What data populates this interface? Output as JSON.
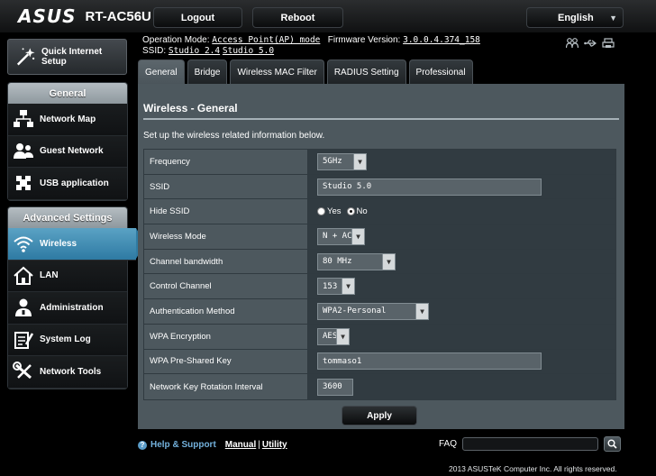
{
  "header": {
    "brand": "ASUS",
    "model": "RT-AC56U",
    "logout_label": "Logout",
    "reboot_label": "Reboot",
    "language": "English"
  },
  "info": {
    "operation_mode_label": "Operation Mode:",
    "operation_mode_value": "Access Point(AP) mode",
    "firmware_label": "Firmware Version:",
    "firmware_value": "3.0.0.4.374_158",
    "ssid_label": "SSID:",
    "ssid_1": "Studio 2.4",
    "ssid_2": "Studio 5.0",
    "status_icons": [
      "clients-icon",
      "usb-icon",
      "printer-icon"
    ]
  },
  "sidebar": {
    "quick_setup_label": "Quick Internet Setup",
    "general_title": "General",
    "general_items": [
      {
        "label": "Network Map",
        "icon": "network-map-icon"
      },
      {
        "label": "Guest Network",
        "icon": "guest-network-icon"
      },
      {
        "label": "USB application",
        "icon": "usb-application-icon"
      }
    ],
    "advanced_title": "Advanced Settings",
    "advanced_items": [
      {
        "label": "Wireless",
        "icon": "wireless-icon",
        "active": true
      },
      {
        "label": "LAN",
        "icon": "lan-icon"
      },
      {
        "label": "Administration",
        "icon": "administration-icon"
      },
      {
        "label": "System Log",
        "icon": "system-log-icon"
      },
      {
        "label": "Network Tools",
        "icon": "network-tools-icon"
      }
    ]
  },
  "tabs": [
    {
      "label": "General",
      "active": true
    },
    {
      "label": "Bridge"
    },
    {
      "label": "Wireless MAC Filter"
    },
    {
      "label": "RADIUS Setting"
    },
    {
      "label": "Professional"
    }
  ],
  "panel": {
    "title": "Wireless - General",
    "description": "Set up the wireless related information below.",
    "fields": {
      "frequency": {
        "label": "Frequency",
        "value": "5GHz"
      },
      "ssid": {
        "label": "SSID",
        "value": "Studio 5.0"
      },
      "hide_ssid": {
        "label": "Hide SSID",
        "yes_label": "Yes",
        "no_label": "No",
        "selected": "No"
      },
      "wireless_mode": {
        "label": "Wireless Mode",
        "value": "N + AC"
      },
      "channel_bandwidth": {
        "label": "Channel bandwidth",
        "value": "80 MHz"
      },
      "control_channel": {
        "label": "Control Channel",
        "value": "153"
      },
      "auth_method": {
        "label": "Authentication Method",
        "value": "WPA2-Personal"
      },
      "wpa_encryption": {
        "label": "WPA Encryption",
        "value": "AES"
      },
      "wpa_psk": {
        "label": "WPA Pre-Shared Key",
        "value": "tommaso1"
      },
      "key_rotation": {
        "label": "Network Key Rotation Interval",
        "value": "3600"
      }
    },
    "apply_label": "Apply"
  },
  "footer": {
    "help_label": "Help & Support",
    "manual_label": "Manual",
    "separator": "|",
    "utility_label": "Utility",
    "faq_label": "FAQ",
    "faq_placeholder": "",
    "copyright": "2013 ASUSTeK Computer Inc. All rights reserved."
  }
}
